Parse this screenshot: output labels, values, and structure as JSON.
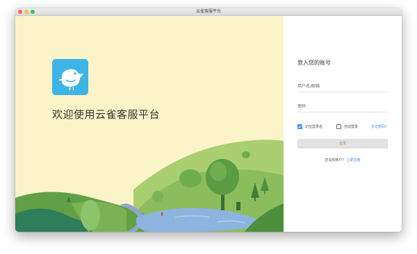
{
  "window": {
    "title": "云雀客服平台"
  },
  "brand": {
    "welcome": "欢迎使用云雀客服平台",
    "accent_color": "#3db4e5",
    "logo_icon": "bird-icon"
  },
  "login": {
    "title": "登入您的账号",
    "username_placeholder": "用户名/邮箱",
    "password_placeholder": "密码",
    "remember_label": "记住登录名",
    "remember_checked": true,
    "auto_login_label": "自动登录",
    "auto_login_checked": false,
    "forgot_link": "忘记密码?",
    "submit_label": "登录",
    "no_account_text": "还没有账户？",
    "register_link": "立即注册",
    "link_color": "#3d8ff0"
  }
}
